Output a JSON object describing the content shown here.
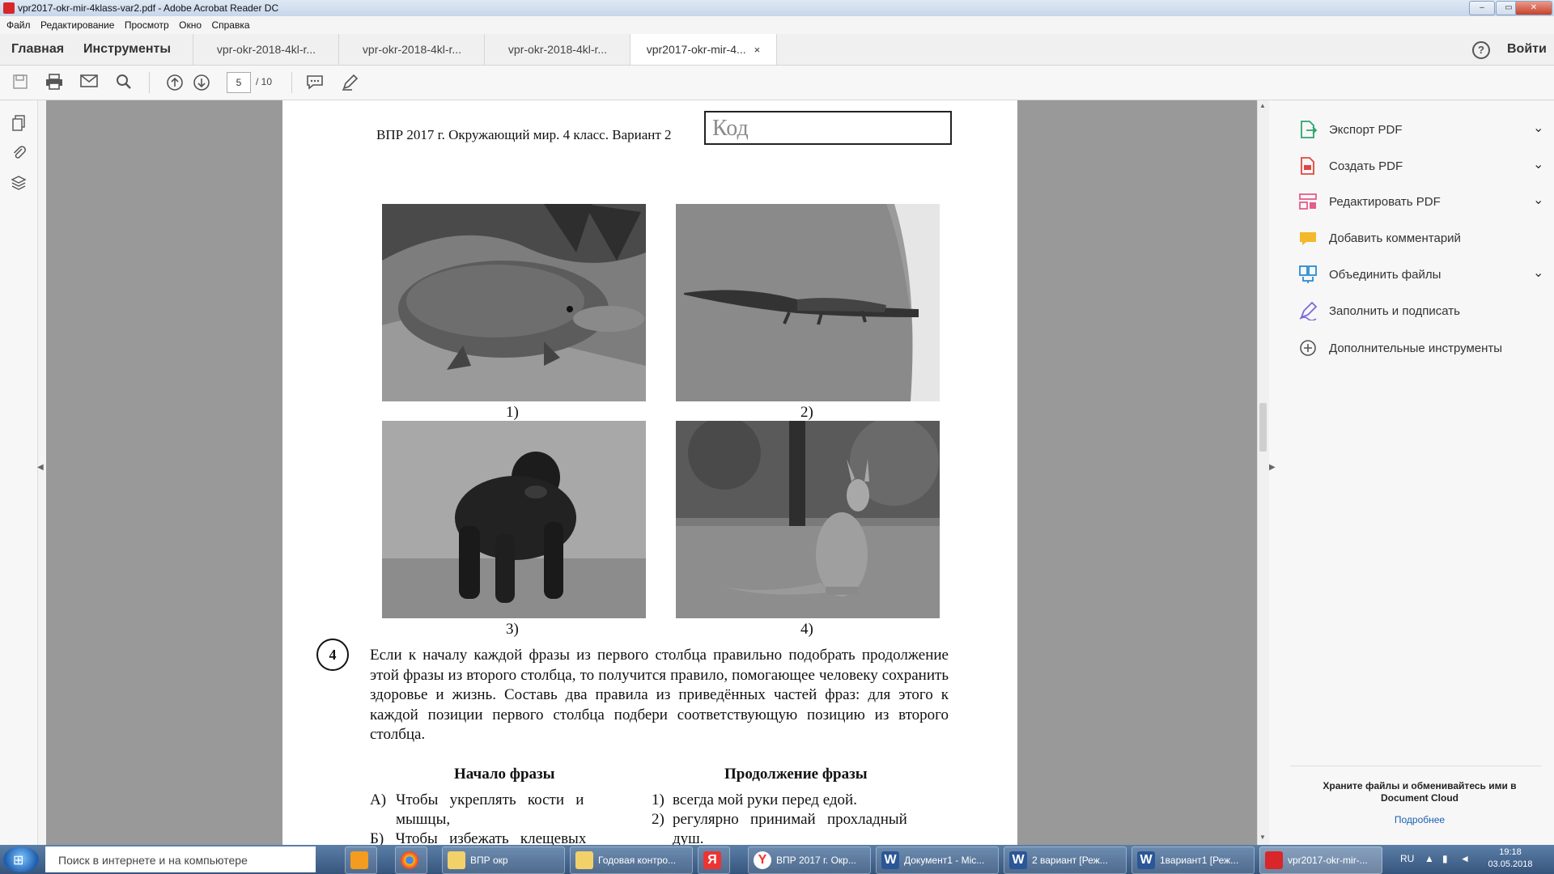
{
  "window": {
    "title": "vpr2017-okr-mir-4klass-var2.pdf - Adobe Acrobat Reader DC"
  },
  "menu": [
    "Файл",
    "Редактирование",
    "Просмотр",
    "Окно",
    "Справка"
  ],
  "nav": {
    "home": "Главная",
    "tools": "Инструменты",
    "signin": "Войти",
    "help": "?"
  },
  "tabs": [
    {
      "label": "vpr-okr-2018-4kl-r..."
    },
    {
      "label": "vpr-okr-2018-4kl-r..."
    },
    {
      "label": "vpr-okr-2018-4kl-r..."
    },
    {
      "label": "vpr2017-okr-mir-4...",
      "active": true,
      "close": "×"
    }
  ],
  "toolbar": {
    "current_page": "5",
    "total_pages": "/ 10"
  },
  "document": {
    "header": "ВПР 2017 г. Окружающий мир. 4 класс. Вариант 2",
    "code_placeholder": "Код",
    "captions": [
      "1)",
      "2)",
      "3)",
      "4)"
    ],
    "question": {
      "number": "4",
      "text": "Если к началу каждой фразы из первого столбца правильно подобрать продолжение этой фразы из второго столбца, то получится правило, помогающее человеку сохранить здоровье и жизнь. Составь два правила из приведённых частей фраз: для этого к каждой позиции первого столбца подбери соответствующую позицию из второго столбца.",
      "col1_header": "Начало фразы",
      "col2_header": "Продолжение фразы",
      "rowA_letter": "А)",
      "rowA_text1": "Чтобы   укреплять   кости   и",
      "rowA_text2": "мышцы,",
      "rowB_partial": "Б)   Чтобы   избежать   клещевых",
      "opt1_num": "1)",
      "opt1_text": "всегда мой руки перед едой.",
      "opt2_num": "2)",
      "opt2_text": "регулярно   принимай   прохладный",
      "opt2_cont": "душ."
    }
  },
  "right_panel": {
    "tools": [
      {
        "label": "Экспорт PDF",
        "icon": "export-pdf-icon",
        "color": "#2ea66f",
        "chevron": true
      },
      {
        "label": "Создать PDF",
        "icon": "create-pdf-icon",
        "color": "#e0473f",
        "chevron": true
      },
      {
        "label": "Редактировать PDF",
        "icon": "edit-pdf-icon",
        "color": "#e65c8c",
        "chevron": true
      },
      {
        "label": "Добавить комментарий",
        "icon": "comment-icon",
        "color": "#f2b92b",
        "chevron": false
      },
      {
        "label": "Объединить файлы",
        "icon": "combine-files-icon",
        "color": "#2a8bd1",
        "chevron": true
      },
      {
        "label": "Заполнить и подписать",
        "icon": "fill-sign-icon",
        "color": "#7a6bd6",
        "chevron": false
      },
      {
        "label": "Дополнительные инструменты",
        "icon": "more-tools-icon",
        "color": "#555555",
        "chevron": false
      }
    ],
    "cloud_text": "Храните файлы и обменивайтесь ими в Document Cloud",
    "cloud_link": "Подробнее"
  },
  "taskbar": {
    "search_placeholder": "Поиск в интернете и на компьютере",
    "apps": [
      {
        "label": "",
        "icon": "media-player-icon"
      },
      {
        "label": "",
        "icon": "chrome-icon"
      },
      {
        "label": "ВПР окр",
        "icon": "folder-icon"
      },
      {
        "label": "Годовая контро...",
        "icon": "folder-icon"
      },
      {
        "label": "",
        "icon": "yandex-icon"
      },
      {
        "label": "ВПР 2017 г. Окр...",
        "icon": "yandex-browser-icon"
      },
      {
        "label": "Документ1 - Mic...",
        "icon": "word-icon"
      },
      {
        "label": "2 вариант [Реж...",
        "icon": "word-icon"
      },
      {
        "label": "1вариант1 [Реж...",
        "icon": "word-icon"
      },
      {
        "label": "vpr2017-okr-mir-...",
        "icon": "acrobat-icon"
      }
    ],
    "lang": "RU",
    "time": "19:18",
    "date": "03.05.2018"
  }
}
